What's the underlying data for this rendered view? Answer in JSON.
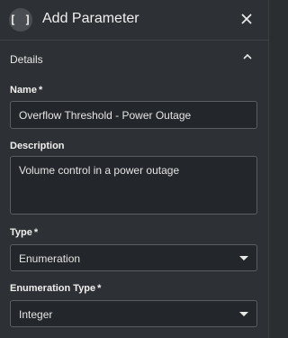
{
  "header": {
    "icon_glyph": "[ ]",
    "title": "Add Parameter",
    "close_icon": "close-icon"
  },
  "section": {
    "title": "Details",
    "collapse_icon": "chevron-up-icon"
  },
  "fields": {
    "name": {
      "label": "Name",
      "required": "*",
      "value": "Overflow Threshold - Power Outage"
    },
    "description": {
      "label": "Description",
      "value": "Volume control in a power outage"
    },
    "type": {
      "label": "Type",
      "required": "*",
      "value": "Enumeration"
    },
    "enumeration_type": {
      "label": "Enumeration Type",
      "required": "*",
      "value": "Integer"
    }
  },
  "colors": {
    "panel_bg": "#2d3034",
    "input_bg": "#23262a",
    "input_border": "#5a5e63",
    "text": "#e6e6e6"
  }
}
